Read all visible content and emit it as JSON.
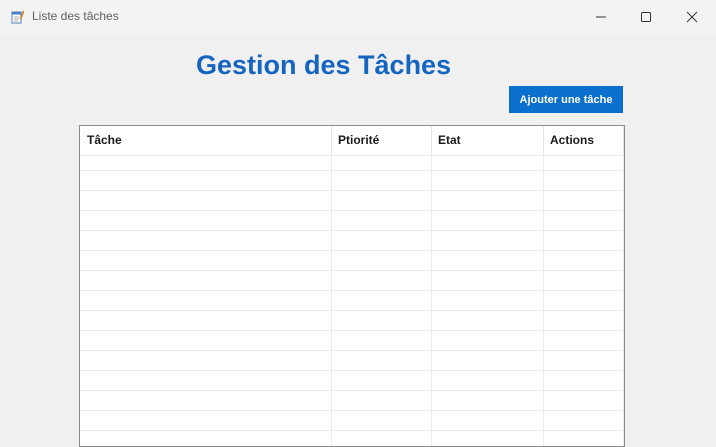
{
  "window": {
    "title": "Liste des tâches",
    "icon": "app-notepad-icon"
  },
  "controls": {
    "minimize": "minimize-icon",
    "maximize": "maximize-icon",
    "close": "close-icon"
  },
  "main": {
    "heading": "Gestion des Tâches",
    "add_button_label": "Ajouter une tâche",
    "accent_color": "#0b6fce",
    "heading_color": "#1565c0"
  },
  "table": {
    "columns": [
      "Tâche",
      "Ptiorité",
      "Etat",
      "Actions"
    ],
    "rows": []
  }
}
